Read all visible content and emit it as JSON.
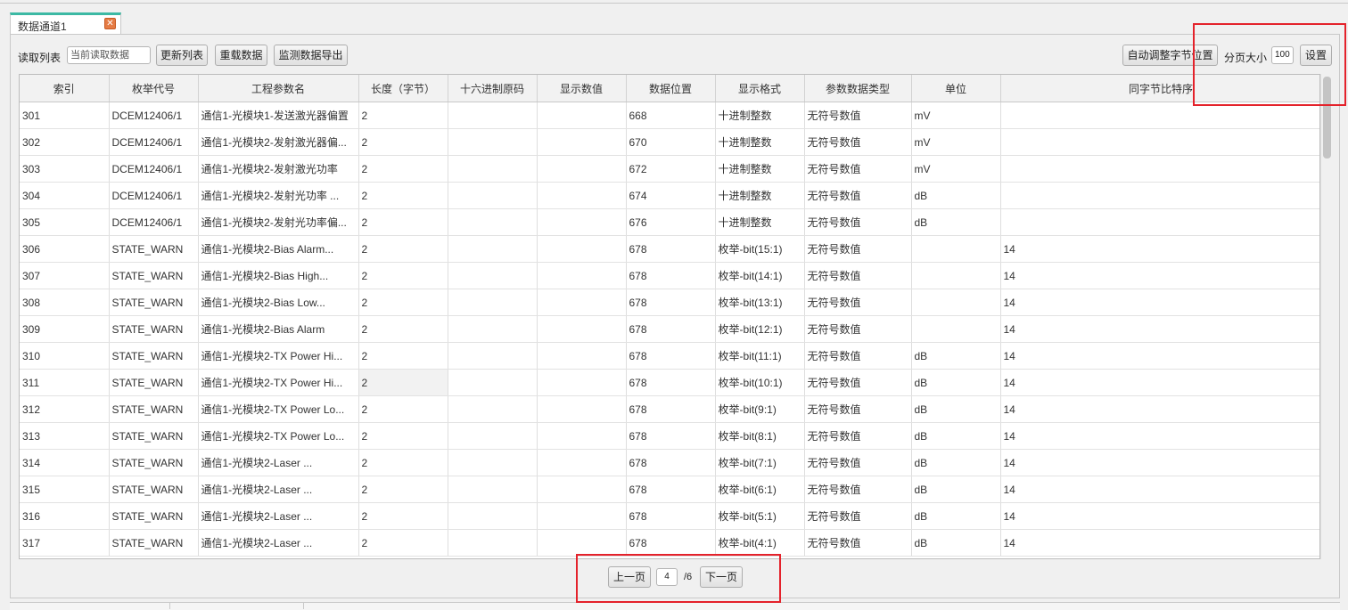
{
  "tab": {
    "title": "数据通道1",
    "close_glyph": "✕"
  },
  "toolbar": {
    "list_label": "读取列表",
    "list_select_value": "当前读取数据",
    "refresh_list": "更新列表",
    "reload_data": "重载数据",
    "export_data": "监测数据导出",
    "auto_adjust": "自动调整字节位置",
    "page_size_label": "分页大小",
    "page_size_value": "100",
    "settings": "设置"
  },
  "table": {
    "columns": [
      "索引",
      "枚举代号",
      "工程参数名",
      "长度（字节）",
      "十六进制原码",
      "显示数值",
      "数据位置",
      "显示格式",
      "参数数据类型",
      "单位",
      "同字节比特序"
    ],
    "rows": [
      [
        "301",
        "DCEM12406/1",
        "通信1-光模块1-发送激光器偏置",
        "2",
        "",
        "",
        "668",
        "十进制整数",
        "无符号数值",
        "mV",
        ""
      ],
      [
        "302",
        "DCEM12406/1",
        "通信1-光模块2-发射激光器偏...",
        "2",
        "",
        "",
        "670",
        "十进制整数",
        "无符号数值",
        "mV",
        ""
      ],
      [
        "303",
        "DCEM12406/1",
        "通信1-光模块2-发射激光功率",
        "2",
        "",
        "",
        "672",
        "十进制整数",
        "无符号数值",
        "mV",
        ""
      ],
      [
        "304",
        "DCEM12406/1",
        "通信1-光模块2-发射光功率 ...",
        "2",
        "",
        "",
        "674",
        "十进制整数",
        "无符号数值",
        "dB",
        ""
      ],
      [
        "305",
        "DCEM12406/1",
        "通信1-光模块2-发射光功率偏...",
        "2",
        "",
        "",
        "676",
        "十进制整数",
        "无符号数值",
        "dB",
        ""
      ],
      [
        "306",
        "STATE_WARN",
        "通信1-光模块2-Bias Alarm...",
        "2",
        "",
        "",
        "678",
        "枚举-bit(15:1)",
        "无符号数值",
        "",
        "14"
      ],
      [
        "307",
        "STATE_WARN",
        "通信1-光模块2-Bias High...",
        "2",
        "",
        "",
        "678",
        "枚举-bit(14:1)",
        "无符号数值",
        "",
        "14"
      ],
      [
        "308",
        "STATE_WARN",
        "通信1-光模块2-Bias Low...",
        "2",
        "",
        "",
        "678",
        "枚举-bit(13:1)",
        "无符号数值",
        "",
        "14"
      ],
      [
        "309",
        "STATE_WARN",
        "通信1-光模块2-Bias Alarm",
        "2",
        "",
        "",
        "678",
        "枚举-bit(12:1)",
        "无符号数值",
        "",
        "14"
      ],
      [
        "310",
        "STATE_WARN",
        "通信1-光模块2-TX Power Hi...",
        "2",
        "",
        "",
        "678",
        "枚举-bit(11:1)",
        "无符号数值",
        "dB",
        "14"
      ],
      [
        "311",
        "STATE_WARN",
        "通信1-光模块2-TX Power Hi...",
        "2",
        "",
        "",
        "678",
        "枚举-bit(10:1)",
        "无符号数值",
        "dB",
        "14"
      ],
      [
        "312",
        "STATE_WARN",
        "通信1-光模块2-TX Power Lo...",
        "2",
        "",
        "",
        "678",
        "枚举-bit(9:1)",
        "无符号数值",
        "dB",
        "14"
      ],
      [
        "313",
        "STATE_WARN",
        "通信1-光模块2-TX Power Lo...",
        "2",
        "",
        "",
        "678",
        "枚举-bit(8:1)",
        "无符号数值",
        "dB",
        "14"
      ],
      [
        "314",
        "STATE_WARN",
        "通信1-光模块2-Laser ...",
        "2",
        "",
        "",
        "678",
        "枚举-bit(7:1)",
        "无符号数值",
        "dB",
        "14"
      ],
      [
        "315",
        "STATE_WARN",
        "通信1-光模块2-Laser ...",
        "2",
        "",
        "",
        "678",
        "枚举-bit(6:1)",
        "无符号数值",
        "dB",
        "14"
      ],
      [
        "316",
        "STATE_WARN",
        "通信1-光模块2-Laser ...",
        "2",
        "",
        "",
        "678",
        "枚举-bit(5:1)",
        "无符号数值",
        "dB",
        "14"
      ],
      [
        "317",
        "STATE_WARN",
        "通信1-光模块2-Laser ...",
        "2",
        "",
        "",
        "678",
        "枚举-bit(4:1)",
        "无符号数值",
        "dB",
        "14"
      ]
    ]
  },
  "pager": {
    "prev": "上一页",
    "current": "4",
    "total": "/6",
    "next": "下一页"
  },
  "colors": {
    "annotation": "#e4222b",
    "tab_accent": "#3cb9a4",
    "close_icon": "#e57b44"
  }
}
